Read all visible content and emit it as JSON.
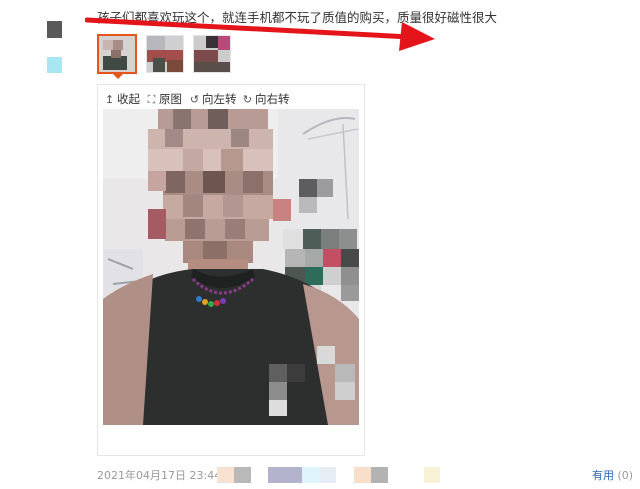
{
  "review": {
    "text": "孩子们都喜欢玩这个，就连手机都不玩了质值的购买，质量很好磁性很大",
    "date": "2021年04月17日",
    "time": "23:44",
    "useful_label": "有用",
    "useful_count": "(0)"
  },
  "thumbnails": [
    {
      "name": "photo-1",
      "selected": true
    },
    {
      "name": "photo-2",
      "selected": false
    },
    {
      "name": "photo-3",
      "selected": false
    }
  ],
  "viewer_toolbar": {
    "collapse_label": "收起",
    "original_label": "原图",
    "rotate_left_label": "向左转",
    "rotate_right_label": "向右转"
  },
  "icons": {
    "collapse": "collapse-up-arrow-icon",
    "original": "expand-icon",
    "rotate_left": "rotate-left-icon",
    "rotate_right": "rotate-right-icon"
  },
  "colors": {
    "accent_arrow": "#e4141b",
    "selected_border": "#e4561c",
    "link": "#2a6ab6",
    "meta_text": "#999999"
  }
}
